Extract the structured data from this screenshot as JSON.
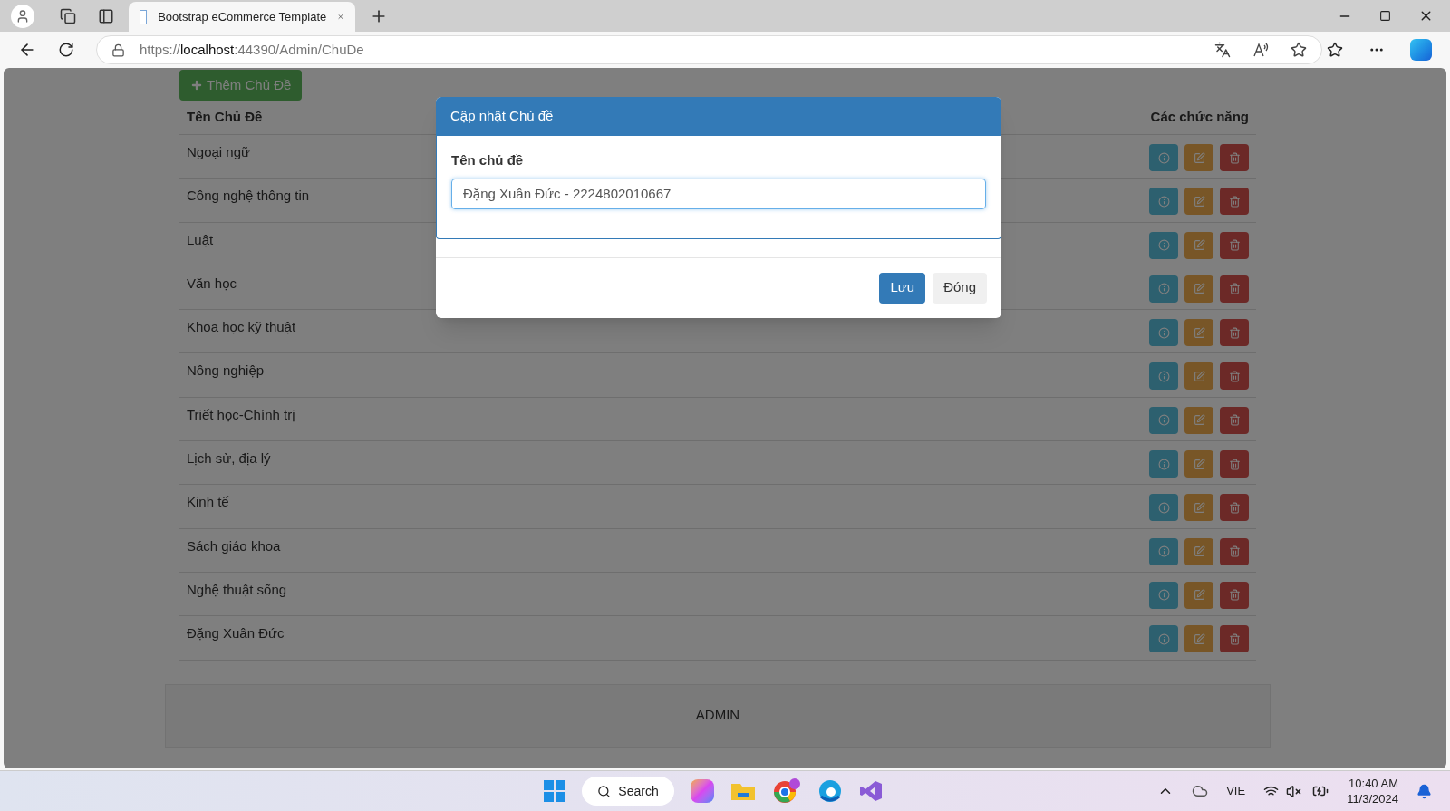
{
  "browser": {
    "tab_title": "Bootstrap eCommerce Template",
    "url_prefix": "https://",
    "url_host": "localhost",
    "url_rest": ":44390/Admin/ChuDe"
  },
  "page": {
    "add_button": "Thêm Chủ Đề",
    "columns": [
      "Tên Chủ Đề",
      "Các chức năng"
    ],
    "rows": [
      "Ngoại ngữ",
      "Công nghệ thông tin",
      "Luật",
      "Văn học",
      "Khoa học kỹ thuật",
      "Nông nghiệp",
      "Triết học-Chính trị",
      "Lịch sử, địa lý",
      "Kinh tế",
      "Sách giáo khoa",
      "Nghệ thuật sống",
      "Đặng Xuân Đức"
    ],
    "footer": "ADMIN"
  },
  "modal": {
    "title": "Cập nhật Chủ đề",
    "field_label": "Tên chủ đề",
    "field_value": "Đặng Xuân Đức - 2224802010667",
    "buttons": [
      {
        "label": "Lưu",
        "kind": "primary"
      },
      {
        "label": "Đóng",
        "kind": "default"
      }
    ]
  },
  "taskbar": {
    "search": "Search",
    "language": "VIE",
    "time": "10:40 AM",
    "date": "11/3/2024"
  }
}
